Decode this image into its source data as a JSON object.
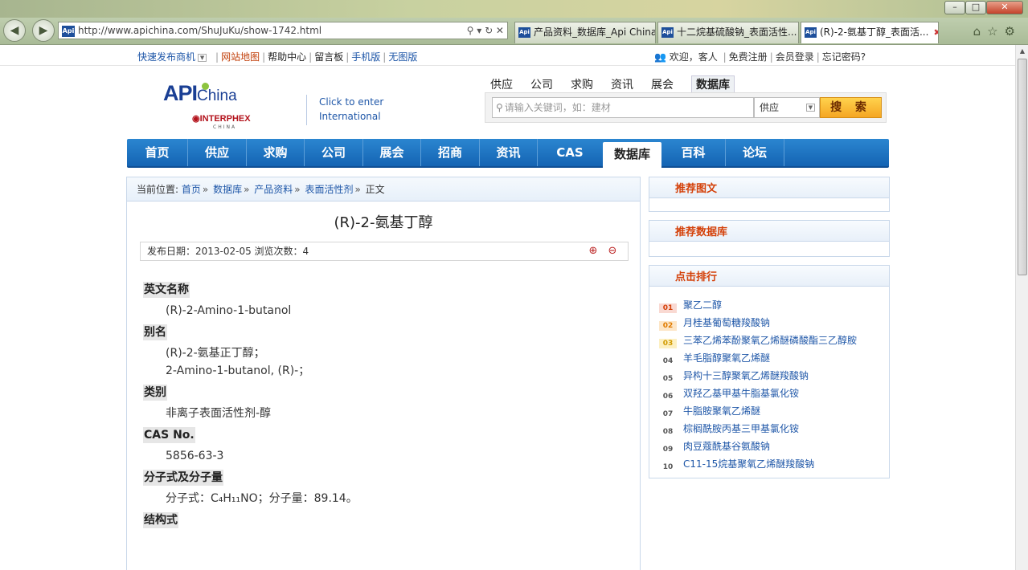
{
  "browser": {
    "address": "http://www.apichina.com/ShuJuKu/show-1742.html",
    "tabs": [
      {
        "title": "产品资料_数据库_Api China"
      },
      {
        "title": "十二烷基硫酸钠_表面活性..."
      },
      {
        "title": "(R)-2-氨基丁醇_表面活..."
      }
    ]
  },
  "topbar": {
    "quick_publish": "快速发布商机",
    "sitemap": "网站地图",
    "help": "帮助中心",
    "guestbook": "留言板",
    "mobile": "手机版",
    "no_image": "无图版",
    "welcome": "欢迎，客人",
    "register": "免费注册",
    "login": "会员登录",
    "forgot": "忘记密码?"
  },
  "logo": {
    "api": "API",
    "china": "China",
    "interphex": "INTERPHEX",
    "interphex_sub": "CHINA"
  },
  "intl_link": {
    "line1": "Click to enter",
    "line2": "International"
  },
  "search": {
    "tabs": [
      "供应",
      "公司",
      "求购",
      "资讯",
      "展会",
      "数据库"
    ],
    "active_tab": "数据库",
    "placeholder": "请输入关键词，如：建材",
    "select": "供应",
    "button": "搜 索"
  },
  "mainnav": [
    "首页",
    "供应",
    "求购",
    "公司",
    "展会",
    "招商",
    "资讯",
    "CAS",
    "数据库",
    "百科",
    "论坛"
  ],
  "breadcrumb": {
    "prefix": "当前位置:",
    "items": [
      "首页",
      "数据库",
      "产品资料",
      "表面活性剂"
    ],
    "current": "正文"
  },
  "article": {
    "title": "(R)-2-氨基丁醇",
    "meta": "发布日期：2013-02-05  浏览次数：4",
    "sections": [
      {
        "head": "英文名称",
        "lines": [
          "(R)-2-Amino-1-butanol"
        ]
      },
      {
        "head": "别名",
        "lines": [
          "(R)-2-氨基正丁醇；",
          "2-Amino-1-butanol, (R)-；"
        ]
      },
      {
        "head": "类别",
        "lines": [
          "非离子表面活性剂-醇"
        ]
      },
      {
        "head": "CAS No.",
        "lines": [
          "5856-63-3"
        ]
      },
      {
        "head": "分子式及分子量",
        "lines": [
          "分子式：C₄H₁₁NO；分子量：89.14。"
        ]
      },
      {
        "head": "结构式",
        "lines": []
      }
    ]
  },
  "sidebar": {
    "box1_title": "推荐图文",
    "box2_title": "推荐数据库",
    "box3_title": "点击排行",
    "ranking": [
      {
        "num": "01",
        "label": "聚乙二醇"
      },
      {
        "num": "02",
        "label": "月桂基葡萄糖羧酸钠"
      },
      {
        "num": "03",
        "label": "三苯乙烯苯酚聚氧乙烯醚磷酸酯三乙醇胺"
      },
      {
        "num": "04",
        "label": "羊毛脂醇聚氧乙烯醚"
      },
      {
        "num": "05",
        "label": "异构十三醇聚氧乙烯醚羧酸钠"
      },
      {
        "num": "06",
        "label": "双羟乙基甲基牛脂基氯化铵"
      },
      {
        "num": "07",
        "label": "牛脂胺聚氧乙烯醚"
      },
      {
        "num": "08",
        "label": "棕榈酰胺丙基三甲基氯化铵"
      },
      {
        "num": "09",
        "label": "肉豆蔻酰基谷氨酸钠"
      },
      {
        "num": "10",
        "label": "C11-15烷基聚氧乙烯醚羧酸钠"
      }
    ]
  }
}
